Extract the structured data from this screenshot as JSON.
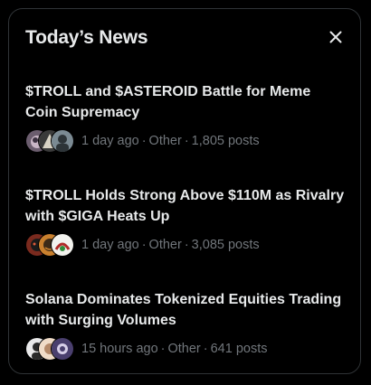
{
  "header": {
    "title": "Today’s News"
  },
  "news": [
    {
      "headline": "$TROLL and $ASTEROID Battle for Meme Coin Supremacy",
      "time": "1 day ago",
      "category": "Other",
      "posts": "1,805 posts",
      "avatars": [
        {
          "name": "avatar-1",
          "bg": "#6b5d6e",
          "fg": "#c9b6c6"
        },
        {
          "name": "avatar-2",
          "bg": "#3a3a3a",
          "fg": "#d8d2c4"
        },
        {
          "name": "avatar-3",
          "bg": "#7b8a93",
          "fg": "#2d3438"
        }
      ]
    },
    {
      "headline": "$TROLL Holds Strong Above $110M as Rivalry with $GIGA Heats Up",
      "time": "1 day ago",
      "category": "Other",
      "posts": "3,085 posts",
      "avatars": [
        {
          "name": "avatar-1",
          "bg": "#7a2a1e",
          "fg": "#1b1b1b"
        },
        {
          "name": "avatar-2",
          "bg": "#c9802e",
          "fg": "#3c2a18"
        },
        {
          "name": "avatar-3",
          "bg": "#f2f2ee",
          "fg": "#b02a28"
        }
      ]
    },
    {
      "headline": "Solana Dominates Tokenized Equities Trading with Surging Volumes",
      "time": "15 hours ago",
      "category": "Other",
      "posts": "641 posts",
      "avatars": [
        {
          "name": "avatar-1",
          "bg": "#e9e9ea",
          "fg": "#2a2a2a"
        },
        {
          "name": "avatar-2",
          "bg": "#f0dcc8",
          "fg": "#b58a6a"
        },
        {
          "name": "avatar-3",
          "bg": "#4a3f6e",
          "fg": "#d7cfe8"
        }
      ]
    }
  ],
  "colors": {
    "background": "#000000",
    "text_primary": "#e7e9ea",
    "text_secondary": "#71767b",
    "border": "#2f3336"
  },
  "icons": {
    "close": "close-icon"
  }
}
